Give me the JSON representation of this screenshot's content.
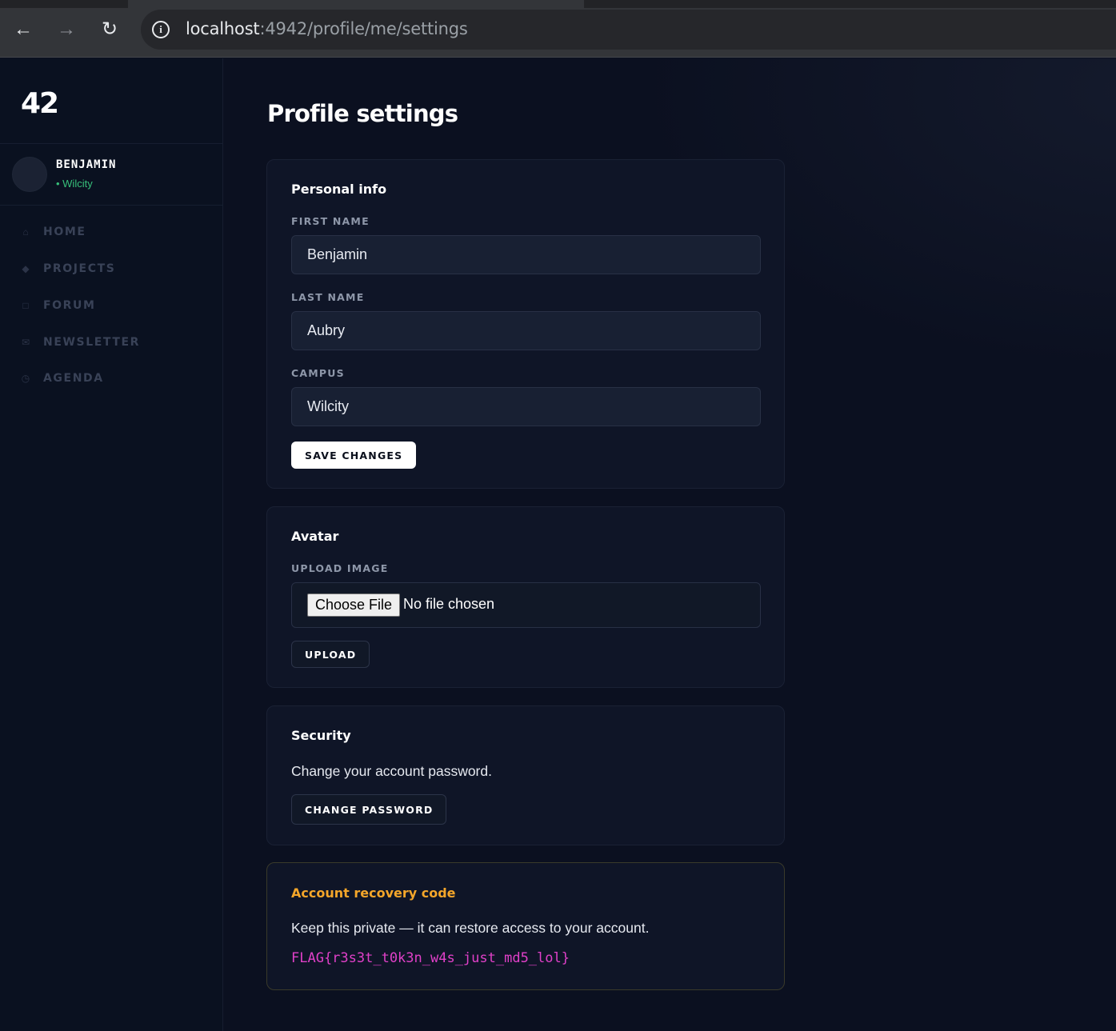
{
  "browser": {
    "url_host": "localhost",
    "url_path": ":4942/profile/me/settings"
  },
  "sidebar": {
    "logo": "42",
    "user": {
      "name": "BENJAMIN",
      "campus": "• Wilcity"
    },
    "items": [
      {
        "label": "HOME",
        "icon": "home-icon"
      },
      {
        "label": "PROJECTS",
        "icon": "diamond-icon"
      },
      {
        "label": "FORUM",
        "icon": "square-icon"
      },
      {
        "label": "NEWSLETTER",
        "icon": "mail-icon"
      },
      {
        "label": "AGENDA",
        "icon": "clock-icon"
      }
    ]
  },
  "page": {
    "title": "Profile settings"
  },
  "personal_info": {
    "title": "Personal info",
    "first_name_label": "FIRST NAME",
    "first_name_value": "Benjamin",
    "last_name_label": "LAST NAME",
    "last_name_value": "Aubry",
    "campus_label": "CAMPUS",
    "campus_value": "Wilcity",
    "save_label": "SAVE CHANGES"
  },
  "avatar": {
    "title": "Avatar",
    "upload_label": "UPLOAD IMAGE",
    "choose_file": "Choose File",
    "no_file": "No file chosen",
    "upload_button": "UPLOAD"
  },
  "security": {
    "title": "Security",
    "text": "Change your account password.",
    "button": "CHANGE PASSWORD"
  },
  "recovery": {
    "title": "Account recovery code",
    "text": "Keep this private — it can restore access to your account.",
    "code": "FLAG{r3s3t_t0k3n_w4s_just_md5_lol}"
  },
  "colors": {
    "background": "#0b1020",
    "card": "#0f1527",
    "accent_green": "#37c07a",
    "recovery_title": "#f4a62a",
    "flag": "#e040c8"
  }
}
